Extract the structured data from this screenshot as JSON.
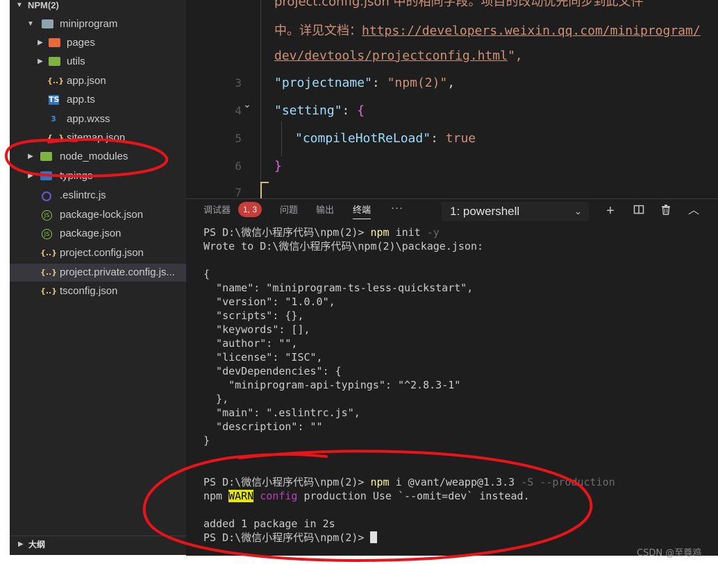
{
  "explorer": {
    "root": "NPM(2)",
    "items": [
      {
        "label": "miniprogram",
        "icon": "folder-open-icon"
      },
      {
        "label": "pages",
        "icon": "folder-icon"
      },
      {
        "label": "utils",
        "icon": "folder-icon"
      },
      {
        "label": "app.json",
        "icon": "json-icon"
      },
      {
        "label": "app.ts",
        "icon": "ts-icon"
      },
      {
        "label": "app.wxss",
        "icon": "css-icon"
      },
      {
        "label": "sitemap.json",
        "icon": "json-icon"
      },
      {
        "label": "node_modules",
        "icon": "folder-icon"
      },
      {
        "label": "typings",
        "icon": "folder-icon"
      },
      {
        "label": ".eslintrc.js",
        "icon": "eslint-icon"
      },
      {
        "label": "package-lock.json",
        "icon": "npm-icon"
      },
      {
        "label": "package.json",
        "icon": "npm-icon"
      },
      {
        "label": "project.config.json",
        "icon": "json-icon"
      },
      {
        "label": "project.private.config.js...",
        "icon": "json-icon"
      },
      {
        "label": "tsconfig.json",
        "icon": "json-icon"
      }
    ],
    "outline": "大纲"
  },
  "editor": {
    "line_numbers": [
      "3",
      "4",
      "5",
      "6",
      "7"
    ],
    "wrap1_a": "project.config.json 中的相同字段。项目的改动优先同步到此文件",
    "wrap2_a": "中。详见文档：",
    "wrap2_url": "https://developers.weixin.qq.com/miniprogram/",
    "wrap3_url": "dev/devtools/projectconfig.html",
    "wrap3_end": "\",",
    "l3_key": "\"projectname\"",
    "l3_sep": ": ",
    "l3_val": "\"npm(2)\"",
    "l3_end": ",",
    "l4_key": "\"setting\"",
    "l4_sep": ": ",
    "l4_brace": "{",
    "l5_key": "\"compileHotReLoad\"",
    "l5_sep": ": ",
    "l5_val": "true",
    "l6_brace": "}"
  },
  "panel": {
    "tabs": {
      "debug": "调试器",
      "problems": "问题",
      "output": "输出",
      "terminal": "终端"
    },
    "badge": "1, 3",
    "more": "···",
    "shell": "1: powershell",
    "icons": [
      "plus-icon",
      "split-icon",
      "trash-icon",
      "chevron-up-icon"
    ]
  },
  "terminal": {
    "prompt": "PS D:\\微信小程序代码\\npm(2)> ",
    "cmd1": "npm",
    "cmd1_rest": " init ",
    "cmd1_flag": "-y",
    "wrote": "Wrote to D:\\微信小程序代码\\npm(2)\\package.json:",
    "json_lines": [
      "{",
      "  \"name\": \"miniprogram-ts-less-quickstart\",",
      "  \"version\": \"1.0.0\",",
      "  \"scripts\": {},",
      "  \"keywords\": [],",
      "  \"author\": \"\",",
      "  \"license\": \"ISC\",",
      "  \"devDependencies\": {",
      "    \"miniprogram-api-typings\": \"^2.8.3-1\"",
      "  },",
      "  \"main\": \".eslintrc.js\",",
      "  \"description\": \"\"",
      "}"
    ],
    "cmd2": "npm",
    "cmd2_rest": " i @vant/weapp@1.3.3 ",
    "cmd2_flag": "-S --production",
    "warn_pre": "npm ",
    "warn": "WARN",
    "warn_cfg": " config",
    "warn_msg": " production Use `--omit=dev` instead.",
    "added": "added 1 package in 2s"
  },
  "watermark": "CSDN @至尊鸡",
  "colors": {
    "sidebar": "#252526",
    "editor": "#1e1e1e",
    "annotation": "#e8141a",
    "warn_bg": "#e5e510",
    "badge": "#c93c37"
  }
}
